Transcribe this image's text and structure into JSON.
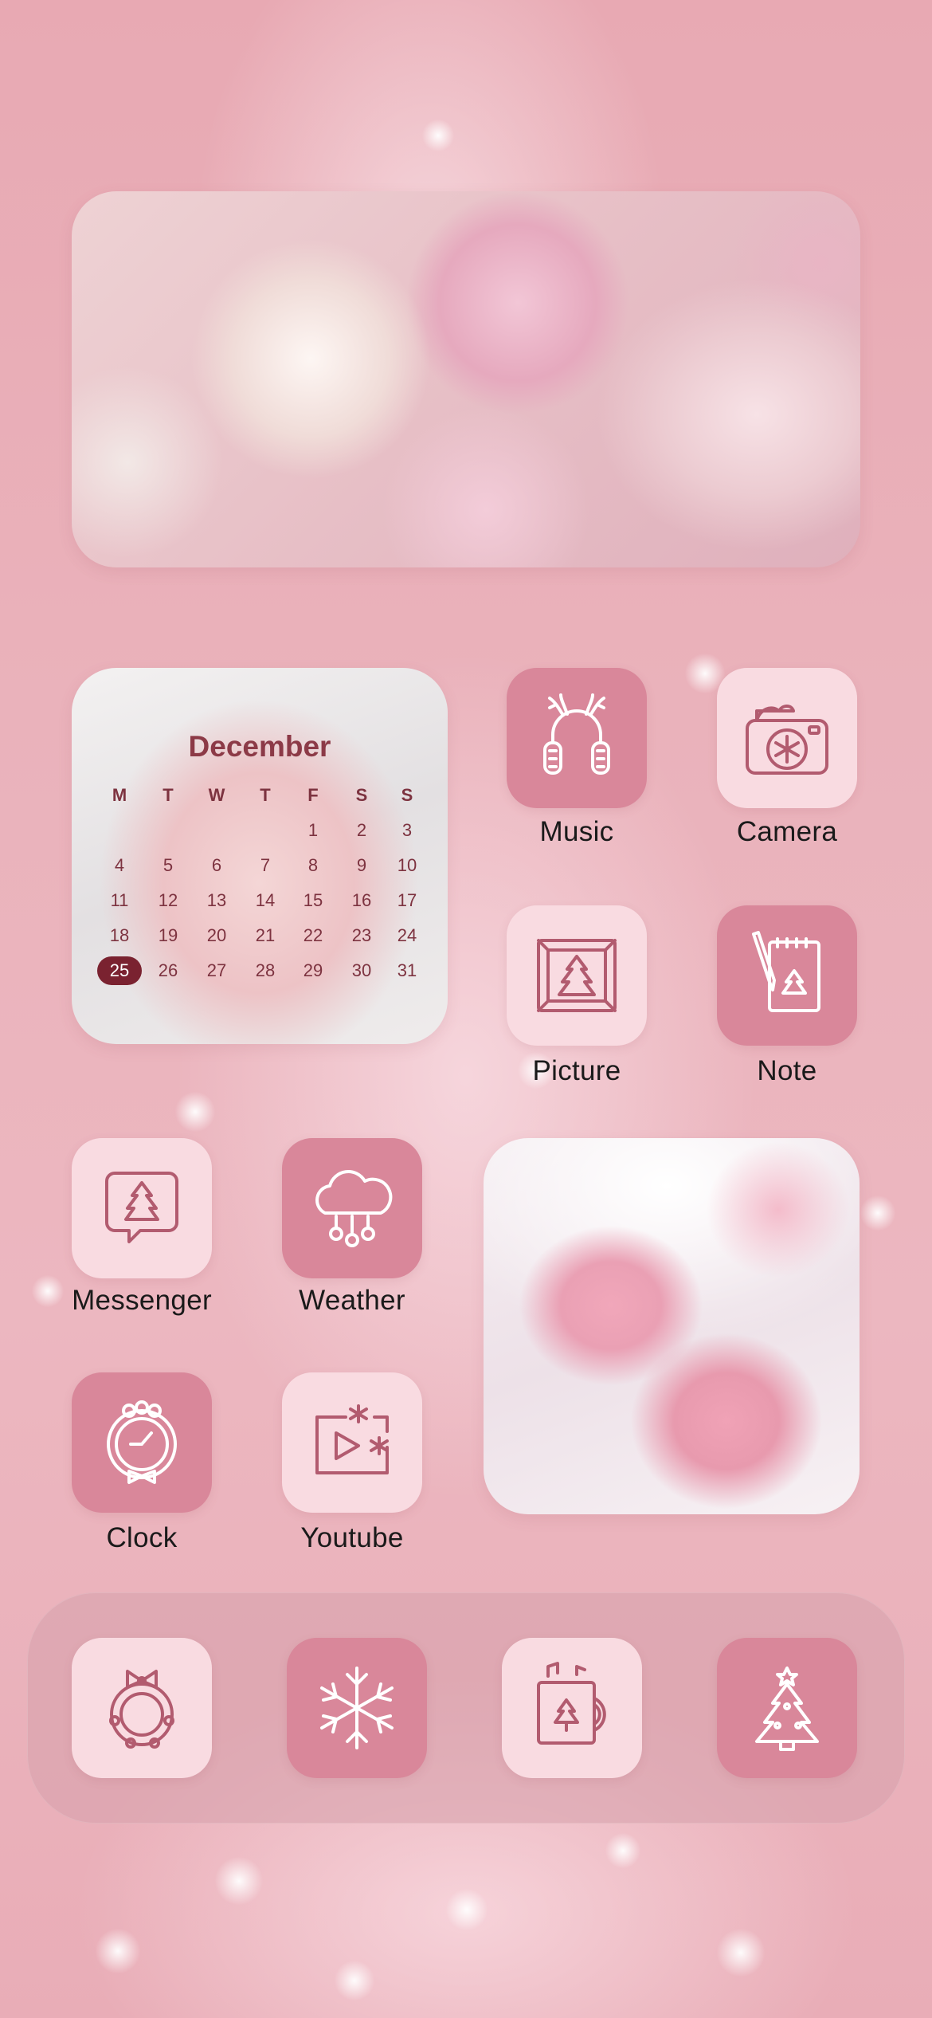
{
  "calendar": {
    "month": "December",
    "weekdays": [
      "M",
      "T",
      "W",
      "T",
      "F",
      "S",
      "S"
    ],
    "weeks": [
      [
        "",
        "",
        "",
        "",
        "1",
        "2",
        "3"
      ],
      [
        "4",
        "5",
        "6",
        "7",
        "8",
        "9",
        "10"
      ],
      [
        "11",
        "12",
        "13",
        "14",
        "15",
        "16",
        "17"
      ],
      [
        "18",
        "19",
        "20",
        "21",
        "22",
        "23",
        "24"
      ],
      [
        "25",
        "26",
        "27",
        "28",
        "29",
        "30",
        "31"
      ]
    ],
    "today": "25"
  },
  "apps": {
    "music": "Music",
    "camera": "Camera",
    "picture": "Picture",
    "note": "Note",
    "messenger": "Messenger",
    "weather": "Weather",
    "clock": "Clock",
    "youtube": "Youtube"
  },
  "dock": {
    "icons": [
      "wreath-icon",
      "snowflake-icon",
      "music-mug-icon",
      "christmas-tree-icon"
    ]
  },
  "colors": {
    "icon_dark_bg": "#d9879a",
    "icon_light_bg": "#f9dbe1",
    "calendar_today": "#7a2230",
    "calendar_text": "#8c3a47"
  }
}
